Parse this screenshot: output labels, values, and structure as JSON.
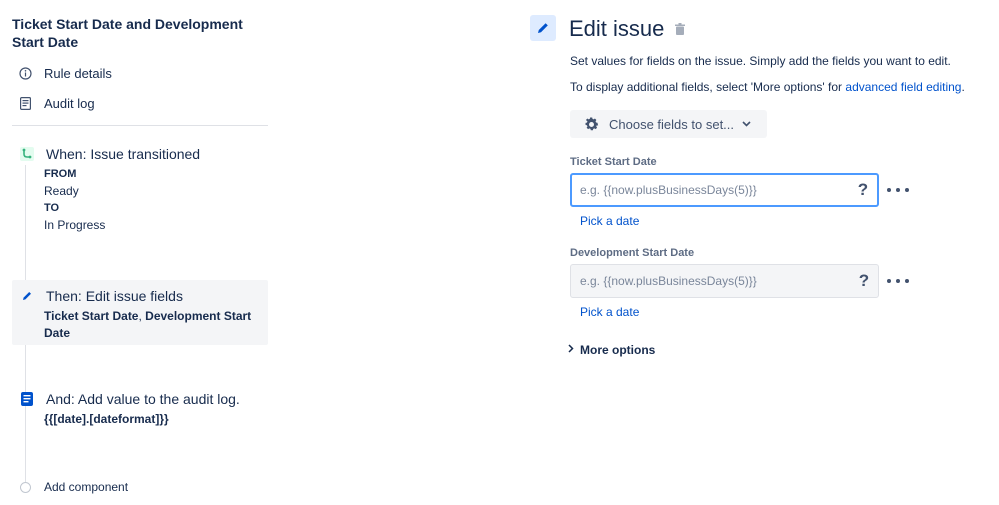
{
  "rule": {
    "title": "Ticket Start Date and Development Start Date",
    "details_label": "Rule details",
    "audit_label": "Audit log"
  },
  "steps": [
    {
      "head": "When: Issue transitioned",
      "lines": [
        "FROM",
        "Ready",
        "TO",
        "In Progress"
      ],
      "icon": "branch-icon",
      "icon_color": "#36b37e"
    },
    {
      "head": "Then: Edit issue fields",
      "bold1": "Ticket Start Date",
      "sep": ", ",
      "bold2": "Development Start Date",
      "icon": "pencil-icon",
      "icon_color": "#0052cc"
    },
    {
      "head": "And: Add value to the audit log.",
      "sub": "{{[date].[dateformat]}}",
      "icon": "audit-log-icon",
      "icon_color": "#0052cc"
    }
  ],
  "add_component": "Add component",
  "edit": {
    "title": "Edit issue",
    "desc1": "Set values for fields on the issue. Simply add the fields you want to edit.",
    "desc2_prefix": "To display additional fields, select 'More options' for ",
    "desc2_link": "advanced field editing",
    "desc2_suffix": ".",
    "choose_label": "Choose fields to set...",
    "fields": [
      {
        "label": "Ticket Start Date",
        "placeholder": "e.g. {{now.plusBusinessDays(5)}}",
        "help": "?",
        "pick": "Pick a date"
      },
      {
        "label": "Development Start Date",
        "placeholder": "e.g. {{now.plusBusinessDays(5)}}",
        "help": "?",
        "pick": "Pick a date"
      }
    ],
    "more_options": "More options"
  },
  "colors": {
    "accent": "#0052cc",
    "trigger_green": "#36b37e",
    "focus_border": "#4c9aff"
  }
}
